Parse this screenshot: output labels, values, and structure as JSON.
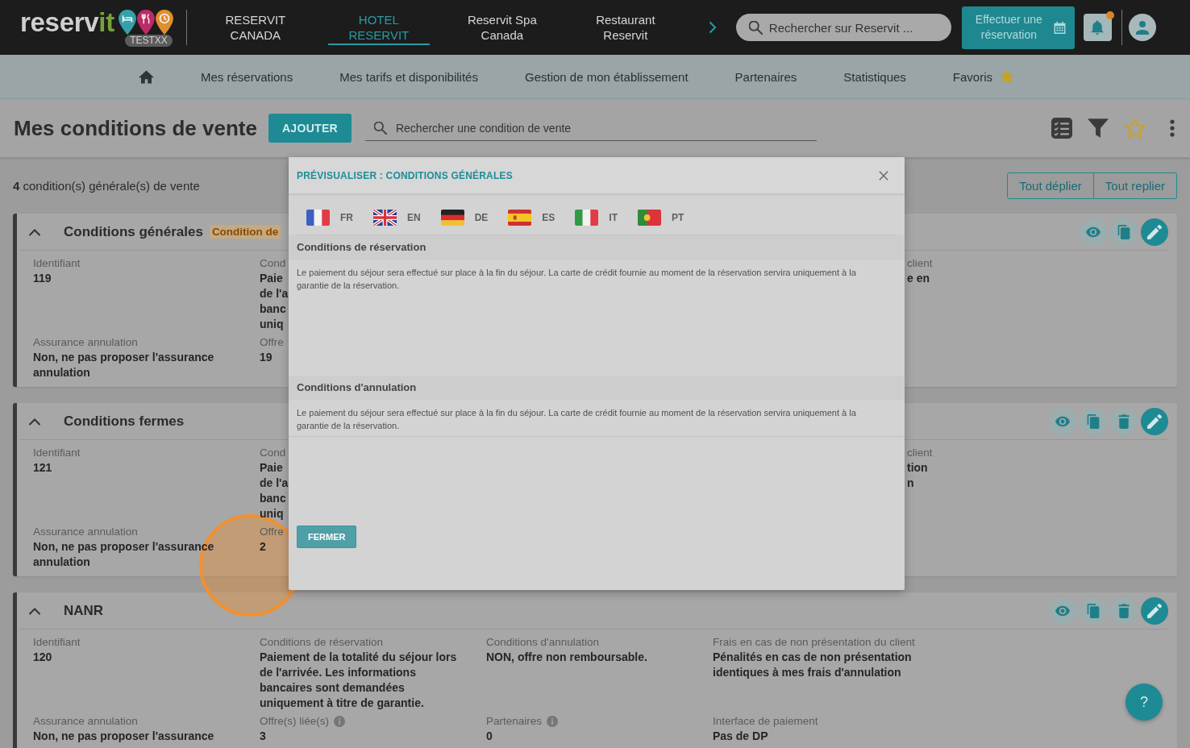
{
  "header": {
    "logo": {
      "text": "reserv",
      "accent": "it"
    },
    "environment": "TESTXX",
    "apps": [
      {
        "label": "RESERVIT CANADA",
        "selected": false
      },
      {
        "label": "HOTEL RESERVIT",
        "selected": true
      },
      {
        "label": "Reservit Spa Canada",
        "selected": false
      },
      {
        "label": "Restaurant Reservit",
        "selected": false
      }
    ],
    "search": {
      "placeholder": "Rechercher sur Reservit ..."
    },
    "booking_button": "Effectuer une réservation",
    "notifications": {
      "unread": true
    }
  },
  "menu": {
    "items": [
      {
        "label": "Mes réservations",
        "kind": "link"
      },
      {
        "label": "Mes tarifs et disponibilités",
        "kind": "link"
      },
      {
        "label": "Gestion de mon établissement",
        "kind": "link"
      },
      {
        "label": "Partenaires",
        "kind": "link"
      },
      {
        "label": "Statistiques",
        "kind": "link"
      },
      {
        "label": "Favoris",
        "kind": "favorites"
      }
    ]
  },
  "page": {
    "title": "Mes conditions de vente",
    "add_button": "AJOUTER",
    "search": {
      "placeholder": "Rechercher une condition de vente"
    },
    "favorite": false,
    "count": "**4** condition(s) générale(s) de vente",
    "expand_all": "Tout déplier",
    "collapse_all": "Tout replier"
  },
  "cards": [
    {
      "title": "Conditions générales",
      "badge": "Condition de",
      "expanded": true,
      "deletable": false,
      "fields": [
        {
          "kind": "cell",
          "label": "Identifiant",
          "value": "119"
        },
        {
          "kind": "cell",
          "label": "Cond",
          "lines": [
            "Paie",
            "de l'a",
            "banc",
            "uniq"
          ]
        },
        {
          "kind": "tail",
          "label": "client",
          "lines": [
            "e en"
          ]
        },
        {
          "kind": "cell",
          "label": "Assurance annulation",
          "value": "Non, ne pas proposer l'assurance annulation"
        },
        {
          "kind": "cell",
          "label": "Offre",
          "value": "19"
        }
      ]
    },
    {
      "title": "Conditions fermes",
      "expanded": true,
      "deletable": true,
      "fields": [
        {
          "kind": "cell",
          "label": "Identifiant",
          "value": "121"
        },
        {
          "kind": "cell",
          "label": "Cond",
          "lines": [
            "Paie",
            "de l'a",
            "banc",
            "uniq"
          ]
        },
        {
          "kind": "tail",
          "label": "client",
          "lines": [
            "tion",
            "n"
          ]
        },
        {
          "kind": "cell",
          "label": "Assurance annulation",
          "value": "Non, ne pas proposer l'assurance annulation"
        },
        {
          "kind": "cell",
          "label": "Offre",
          "value": "2"
        }
      ]
    },
    {
      "title": "NANR",
      "expanded": true,
      "deletable": true,
      "fields": [
        {
          "kind": "cell",
          "label": "Identifiant",
          "value": "120"
        },
        {
          "kind": "cell",
          "label": "Conditions de réservation",
          "value": "Paiement de la totalité du séjour lors de l'arrivée. Les informations bancaires sont demandées uniquement à titre de garantie."
        },
        {
          "kind": "cell",
          "label": "Conditions d'annulation",
          "value": "NON, offre non remboursable."
        },
        {
          "kind": "cell",
          "label": "Frais en cas de non présentation du client",
          "value": "Pénalités en cas de non présentation identiques à mes frais d'annulation"
        },
        {
          "kind": "cell",
          "label": "Assurance annulation",
          "value": "Non, ne pas proposer l'assurance"
        },
        {
          "kind": "cell",
          "label": "Offre(s) liée(s)",
          "value": "3",
          "info": true
        },
        {
          "kind": "cell",
          "label": "Partenaires",
          "value": "0",
          "info": true
        },
        {
          "kind": "cell",
          "label": "Interface de paiement",
          "value": "Pas de DP"
        }
      ]
    }
  ],
  "modal": {
    "title": "PRÉVISUALISER : CONDITIONS GÉNÉRALES",
    "languages": [
      {
        "code": "FR",
        "kind": "france"
      },
      {
        "code": "EN",
        "kind": "uk"
      },
      {
        "code": "DE",
        "kind": "germany"
      },
      {
        "code": "ES",
        "kind": "spain"
      },
      {
        "code": "IT",
        "kind": "italy"
      },
      {
        "code": "PT",
        "kind": "portugal"
      }
    ],
    "sections": [
      {
        "heading": "Conditions de réservation",
        "text": "Le paiement du séjour sera effectué sur place à la fin du séjour. La carte de crédit fournie au moment de la réservation servira uniquement à la garantie de la réservation."
      },
      {
        "heading": "Conditions d'annulation",
        "text": "Le paiement du séjour sera effectué sur place à la fin du séjour. La carte de crédit fournie au moment de la réservation servira uniquement à la garantie de la réservation."
      }
    ],
    "close_button": "FERMER"
  },
  "help_button": "?"
}
